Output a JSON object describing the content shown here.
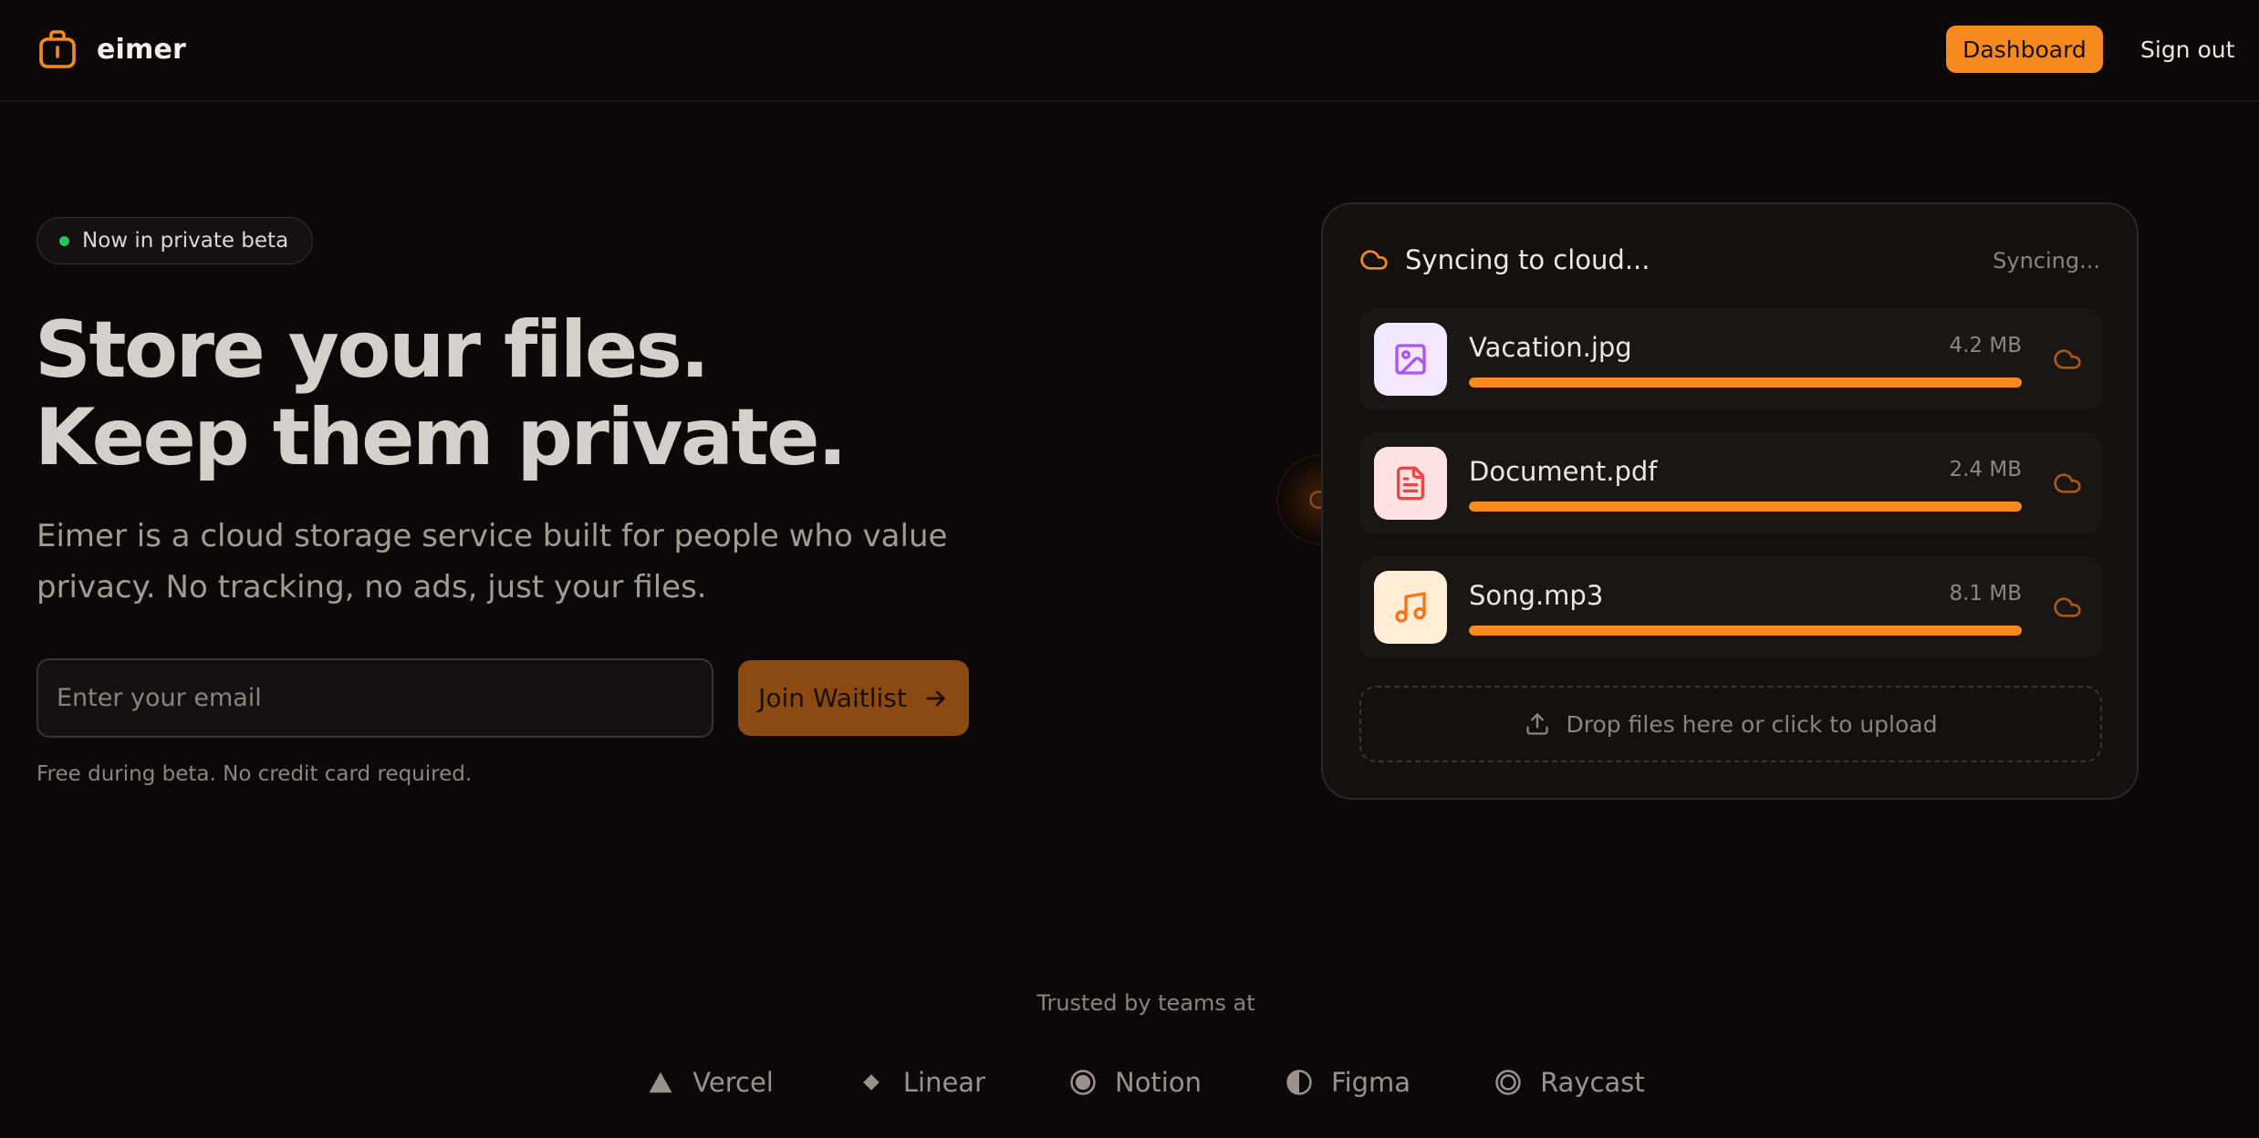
{
  "header": {
    "logo_text": "eimer",
    "dashboard_label": "Dashboard",
    "signout_label": "Sign out"
  },
  "hero": {
    "badge": "Now in private beta",
    "headline_line1": "Store your files.",
    "headline_line2": "Keep them private.",
    "lead": "Eimer is a cloud storage service built for people who value privacy. No tracking, no ads, just your files.",
    "email_placeholder": "Enter your email",
    "email_value": "",
    "cta_label": "Join Waitlist",
    "note": "Free during beta. No credit card required."
  },
  "sync_card": {
    "title": "Syncing to cloud...",
    "status": "Syncing...",
    "files": [
      {
        "name": "Vacation.jpg",
        "size": "4.2 MB",
        "progress": 1.0,
        "icon": "image-icon"
      },
      {
        "name": "Document.pdf",
        "size": "2.4 MB",
        "progress": 1.0,
        "icon": "document-icon"
      },
      {
        "name": "Song.mp3",
        "size": "8.1 MB",
        "progress": 1.0,
        "icon": "music-icon"
      }
    ],
    "dropzone_label": "Drop files here or click to upload"
  },
  "trusted": {
    "label": "Trusted by teams at",
    "brands": [
      {
        "name": "Vercel",
        "icon": "triangle-icon"
      },
      {
        "name": "Linear",
        "icon": "diamond-icon"
      },
      {
        "name": "Notion",
        "icon": "notion-icon"
      },
      {
        "name": "Figma",
        "icon": "figma-icon"
      },
      {
        "name": "Raycast",
        "icon": "raycast-icon"
      }
    ]
  },
  "colors": {
    "accent": "#f68a1f",
    "background": "#0b0807",
    "beta_dot": "#22c55e"
  }
}
